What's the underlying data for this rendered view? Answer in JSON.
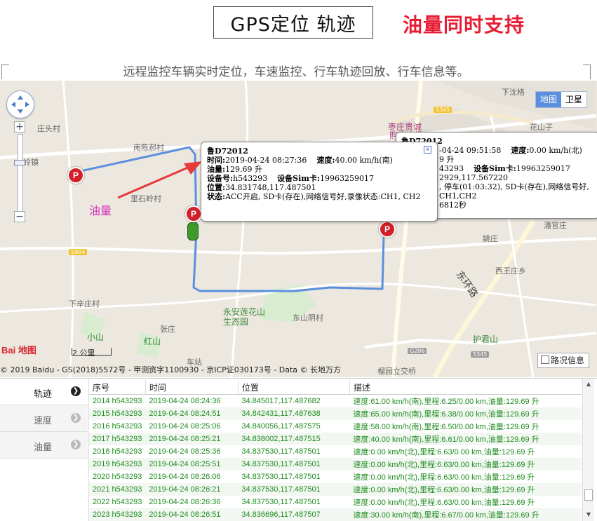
{
  "header": {
    "title": "GPS定位 轨迹",
    "promo": "油量同时支持",
    "subtitle": "远程监控车辆实时定位，车速监控、行车轨迹回放、行车信息等。"
  },
  "colors": {
    "promo_red": "#e81c32",
    "route_blue": "#5b8fde",
    "row_green": "#1e8c1e",
    "marker_red": "#d21f2a"
  },
  "map": {
    "type_buttons": [
      "地图",
      "卫星"
    ],
    "annotation": "油量",
    "places": [
      "下沈格",
      "庄头村",
      "南陈郝村",
      "枣庄贵诚",
      "购物广场",
      "花山子",
      "西王庄乡",
      "姚庄",
      "潘官庄",
      "东环路",
      "下辛庄村",
      "张庄",
      "小山",
      "红山",
      "永安莲花山",
      "生态园",
      "东山阴村",
      "护君山",
      "榴园立交桥",
      "车站",
      "里石岭村",
      "岭镇"
    ],
    "road_badges": [
      "S345",
      "S904",
      "G206",
      "S345"
    ],
    "marker_letter": "P",
    "scale_label": "2 公里",
    "logo": "Bai 地图",
    "traffic_button": "路况信息",
    "copyright": "© 2019 Baidu - GS(2018)5572号 - 甲测资字1100930 - 京ICP证030173号 - Data © 长地万方",
    "popup_main": {
      "plate": "鲁D72012",
      "time_label": "时间:",
      "time": "2019-04-24 08:27:36",
      "speed_label": "速度:",
      "speed": "40.00 km/h(南)",
      "fuel_label": "油量:",
      "fuel": "129.69 升",
      "device_label": "设备号:",
      "device": "h543293",
      "sim_label": "设备Sim卡:",
      "sim": "19963259017",
      "pos_label": "位置:",
      "pos": "34.831748,117.487501",
      "status_label": "状态:",
      "status": "ACC开启, SD卡(存在),网络信号好,录像状态:CH1, CH2",
      "close": "x"
    },
    "popup_back": {
      "plate": "鲁D72012",
      "line1_time": "-04-24 09:51:58",
      "line1_speed_label": "速度:",
      "line1_speed": "0.00 km/h(北)",
      "line2": "9 升",
      "line3_dev": "43293",
      "line3_sim_label": "设备Sim卡:",
      "line3_sim": "19963259017",
      "line4": "2929,117.567220",
      "line5": ", 停车(01:03:32), SD卡(存在),网络信号好,",
      "line6": "CH1,CH2",
      "line7": "6812秒"
    }
  },
  "sidebar": {
    "items": [
      {
        "label": "轨迹",
        "active": true
      },
      {
        "label": "速度",
        "active": false
      },
      {
        "label": "油量",
        "active": false
      }
    ]
  },
  "table": {
    "columns": [
      "序号",
      "时间",
      "位置",
      "描述"
    ],
    "rows": [
      [
        "2014 h543293",
        "2019-04-24 08:24:36",
        "34.845017,117.487682",
        "速度:61.00 km/h(南),里程:6.25/0.00 km,油量:129.69 升"
      ],
      [
        "2015 h543293",
        "2019-04-24 08:24:51",
        "34.842431,117.487638",
        "速度:65.00 km/h(南),里程:6.38/0.00 km,油量:129.69 升"
      ],
      [
        "2016 h543293",
        "2019-04-24 08:25:06",
        "34.840056,117.487575",
        "速度:58.00 km/h(南),里程:6.50/0.00 km,油量:129.69 升"
      ],
      [
        "2017 h543293",
        "2019-04-24 08:25:21",
        "34.838002,117.487515",
        "速度:40.00 km/h(南),里程:6.61/0.00 km,油量:129.69 升"
      ],
      [
        "2018 h543293",
        "2019-04-24 08:25:36",
        "34.837530,117.487501",
        "速度:0.00 km/h(北),里程:6.63/0.00 km,油量:129.69 升"
      ],
      [
        "2019 h543293",
        "2019-04-24 08:25:51",
        "34.837530,117.487501",
        "速度:0.00 km/h(北),里程:6.63/0.00 km,油量:129.69 升"
      ],
      [
        "2020 h543293",
        "2019-04-24 08:26:06",
        "34.837530,117.487501",
        "速度:0.00 km/h(北),里程:6.63/0.00 km,油量:129.69 升"
      ],
      [
        "2021 h543293",
        "2019-04-24 08:26:21",
        "34.837530,117.487501",
        "速度:0.00 km/h(北),里程:6.63/0.00 km,油量:129.69 升"
      ],
      [
        "2022 h543293",
        "2019-04-24 08:26:36",
        "34.837530,117.487501",
        "速度:0.00 km/h(北),里程:6.63/0.00 km,油量:129.69 升"
      ],
      [
        "2023 h543293",
        "2019-04-24 08:26:51",
        "34.836696,117.487507",
        "速度:30.00 km/h(南),里程:6.67/0.00 km,油量:129.69 升"
      ]
    ]
  }
}
